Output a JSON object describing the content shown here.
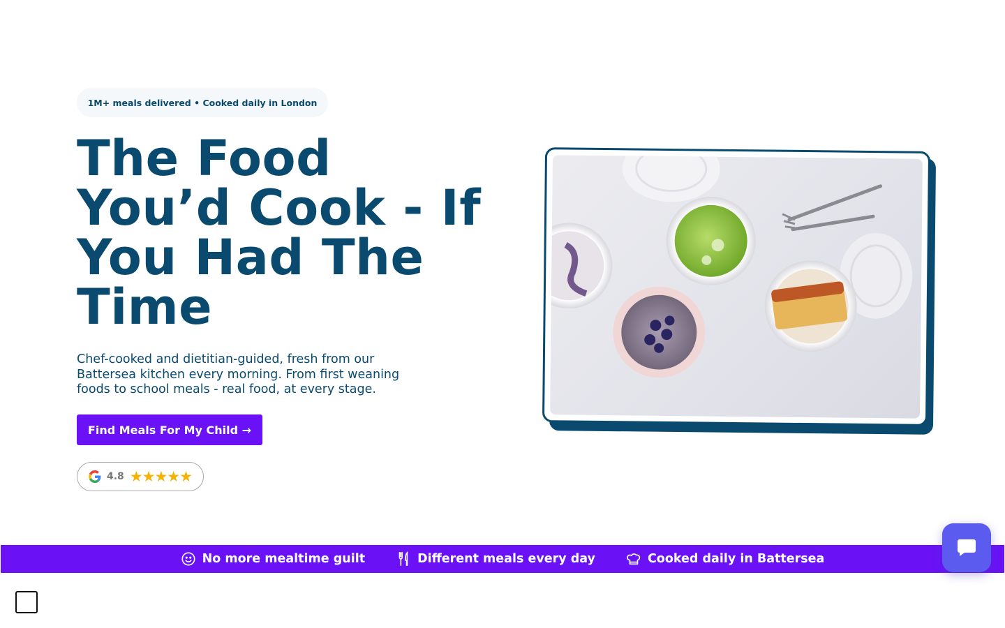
{
  "hero": {
    "badge": "1M+ meals delivered • Cooked daily in London",
    "headline": "The Food You’d Cook - If You Had The Time",
    "subtitle": "Chef-cooked and dietitian-guided, fresh from our Battersea kitchen every morning. From first weaning foods to school meals - real food, at every stage.",
    "cta_label": "Find Meals For My Child →",
    "rating": {
      "provider_icon": "google-icon",
      "score": "4.8",
      "stars": 5,
      "star_glyphs": "★★★★★"
    },
    "image": {
      "subject": "meal pots",
      "icon": "food-photo"
    }
  },
  "banner": {
    "items": [
      {
        "icon": "smile-icon",
        "label": "No more mealtime guilt"
      },
      {
        "icon": "utensils-icon",
        "label": "Different meals every day"
      },
      {
        "icon": "chef-hat-icon",
        "label": "Cooked daily in Battersea"
      }
    ]
  },
  "chat": {
    "icon": "chat-bubble-icon"
  },
  "colors": {
    "brand_navy": "#0b4a6f",
    "brand_purple": "#6a12f5",
    "chat_blue": "#5b5bf0",
    "star_gold": "#f5b301"
  }
}
